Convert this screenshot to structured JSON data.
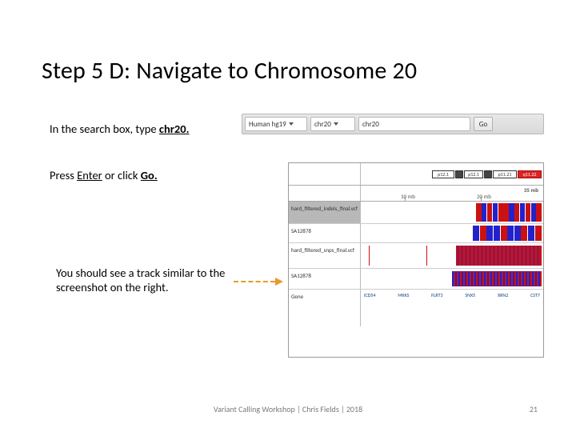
{
  "title": "Step 5 D: Navigate to Chromosome 20",
  "instructions": {
    "line1_a": "In the search box, type ",
    "line1_b": "chr20.",
    "line2_a": "Press ",
    "line2_b": "Enter",
    "line2_c": " or click ",
    "line2_d": "Go.",
    "line3": "You should see a track similar to the screenshot on the right."
  },
  "toolbar": {
    "genome": "Human hg19",
    "chr": "chr20",
    "search": "chr20",
    "go": "Go"
  },
  "igv": {
    "bands": [
      "p12.1",
      "p12.1",
      "p11.21",
      "q11.22"
    ],
    "scale_label": "35 mb",
    "tick1": "10 mb",
    "tick2": "20 mb",
    "rows": {
      "indels": "hard_filtered_indels_final.vcf",
      "sample1": "SA12878",
      "snps": "hard_filtered_snps_final.vcf",
      "sample2": "SA12878",
      "gene": "Gene"
    },
    "genes": [
      "ICD54",
      "MKKS",
      "FLRT3",
      "SNX5",
      "XRN2",
      "CST7"
    ]
  },
  "footer": "Variant Calling Workshop | Chris Fields | 2018",
  "page": "21"
}
